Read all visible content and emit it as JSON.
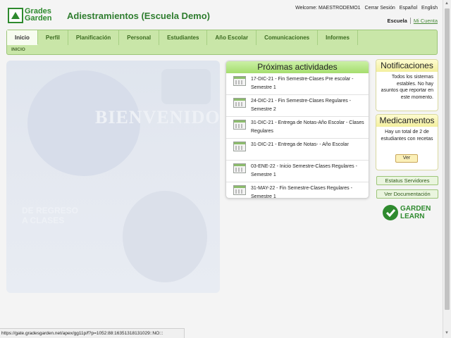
{
  "logo": {
    "line1": "Grades",
    "line2": "Garden"
  },
  "app_title": "Adiestramientos (Escuela Demo)",
  "topbar": {
    "welcome": "Welcome: MAESTRODEMO1",
    "logout": "Cerrar Sesión",
    "lang_es": "Español",
    "lang_en": "English"
  },
  "scope": {
    "active": "Escuela",
    "other": "Mi Cuenta"
  },
  "nav": {
    "tabs": [
      {
        "label": "Inicio"
      },
      {
        "label": "Perfil"
      },
      {
        "label": "Planificación"
      },
      {
        "label": "Personal"
      },
      {
        "label": "Estudiantes"
      },
      {
        "label": "Año Escolar"
      },
      {
        "label": "Comunicaciones"
      },
      {
        "label": "Informes"
      }
    ],
    "breadcrumb": "INICIO"
  },
  "hero": {
    "welcome": "BIENVENIDOS",
    "back_line1": "DE REGRESO",
    "back_line2": "A CLASES"
  },
  "activities": {
    "title": "Próximas actividades",
    "items": [
      "17-DIC-21 - Fin Semestre-Clases Pre escolar - Semestre 1",
      "24-DIC-21 - Fin Semestre-Clases Regulares - Semestre 2",
      "31-DIC-21 - Entrega de Notas-Año Escolar - Clases Regulares",
      "31-DIC-21 - Entrega de Notas- - Año Escolar",
      "03-ENE-22 - Inicio Semestre-Clases Regulares - Semestre 1",
      "31-MAY-22 - Fin Semestre-Clases Regulares - Semestre 1"
    ]
  },
  "notifications": {
    "title": "Notificaciones",
    "text": "Todos los sistemas estables. No hay asuntos que reportar en este momento."
  },
  "medications": {
    "title": "Medicamentos",
    "text": "Hay un total de 2 de estudiantes con recetas",
    "button": "Ver"
  },
  "side_buttons": {
    "status": "Estatus Servidores",
    "docs": "Ver Documentación"
  },
  "garden_learn": {
    "line1": "GARDEN",
    "line2": "LEARN"
  },
  "statusbar": "https://gate.gradesgarden.net/apex/gg11p/f?p=1052:88:16351318131029::NO:::"
}
